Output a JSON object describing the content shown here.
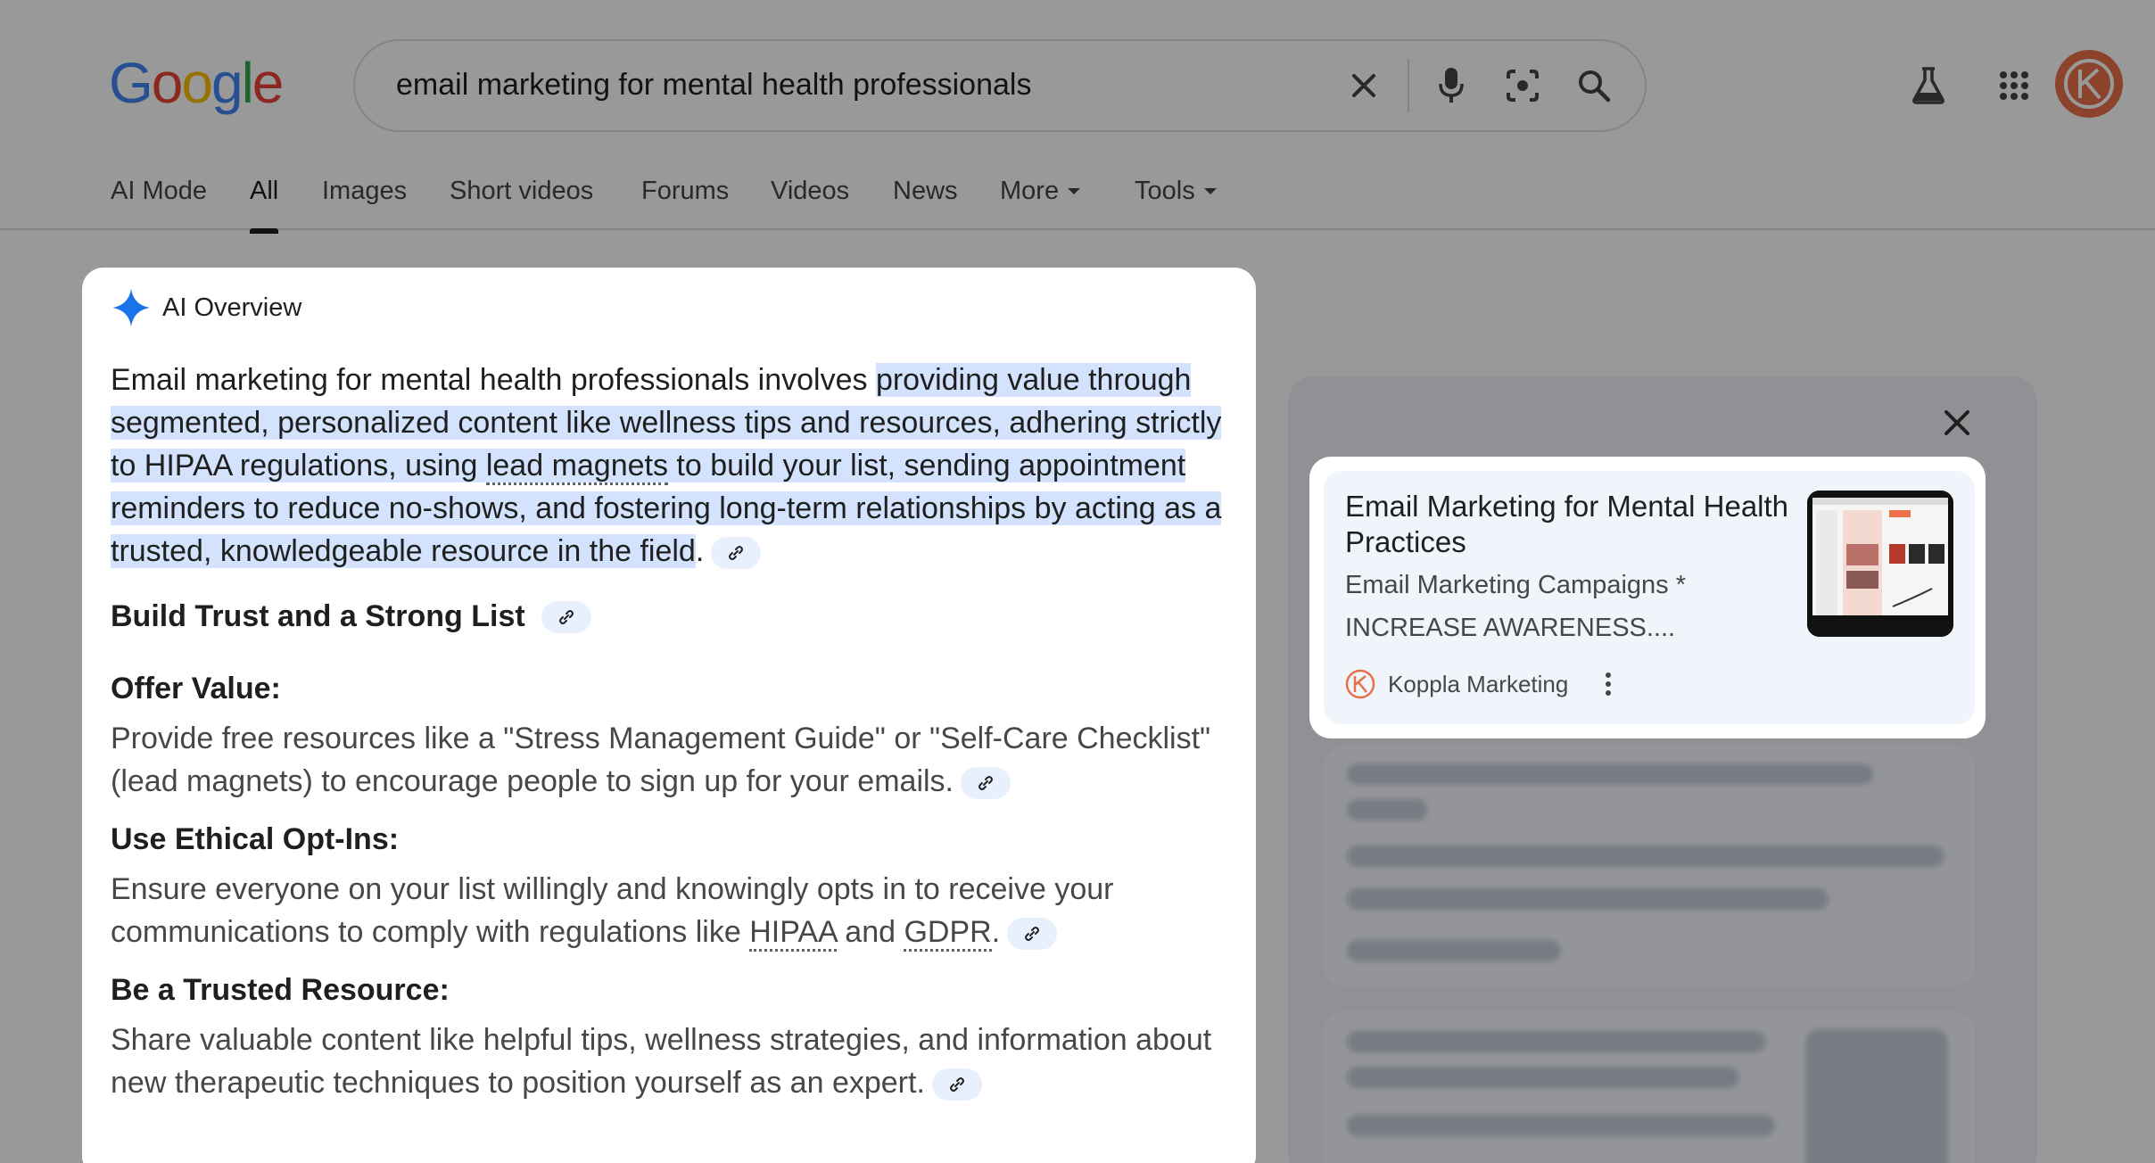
{
  "search": {
    "query": "email marketing for mental health professionals"
  },
  "tabs": [
    {
      "label": "AI Mode"
    },
    {
      "label": "All"
    },
    {
      "label": "Images"
    },
    {
      "label": "Short videos"
    },
    {
      "label": "Forums"
    },
    {
      "label": "Videos"
    },
    {
      "label": "News"
    },
    {
      "label": "More"
    },
    {
      "label": "Tools"
    }
  ],
  "ai_overview": {
    "heading": "AI Overview",
    "intro_plain": "Email marketing for mental health professionals involves ",
    "intro_hl_1": "providing value through segmented, personalized content like wellness tips and resources, adhering strictly to HIPAA regulations, using ",
    "intro_link": "lead magnets",
    "intro_hl_2": " to build your list, sending appointment reminders to reduce no-shows, and fostering long-term relationships by acting as a trusted, knowledgeable resource in the field",
    "intro_end": ".",
    "section_title": "Build Trust and a Strong List",
    "items": [
      {
        "title": "Offer Value:",
        "text": "Provide free resources like a \"Stress Management Guide\" or \"Self-Care Checklist\" (lead magnets) to encourage people to sign up for your emails."
      },
      {
        "title": "Use Ethical Opt-Ins:",
        "text_a": "Ensure everyone on your list willingly and knowingly opts in to receive your communications to comply with regulations like ",
        "term1": "HIPAA",
        "text_b": " and ",
        "term2": "GDPR",
        "text_c": "."
      },
      {
        "title": "Be a Trusted Resource:",
        "text": "Share valuable content like helpful tips, wellness strategies, and information about new therapeutic techniques to position yourself as an expert."
      }
    ]
  },
  "source_card": {
    "title": "Email Marketing for Mental Health Practices",
    "snippet_1": "Email Marketing Campaigns *",
    "snippet_2": "INCREASE AWARENESS....",
    "source_name": "Koppla Marketing"
  },
  "colors": {
    "accent": "#1a73e8",
    "highlight": "#d3e3fd",
    "avatar": "#e8704a"
  }
}
